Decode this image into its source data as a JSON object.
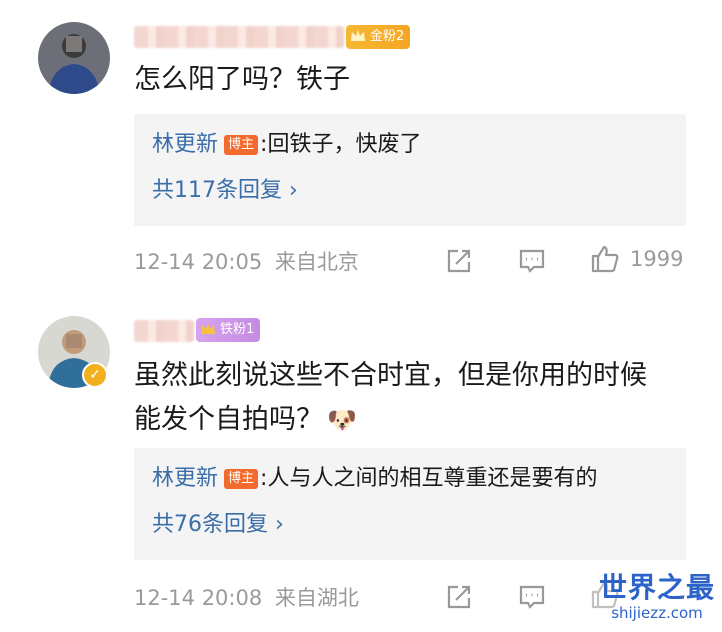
{
  "comments": [
    {
      "fan_badge": "金粉2",
      "text": "怎么阳了吗？铁子",
      "reply": {
        "name": "林更新",
        "op_badge": "博主",
        "content": ":回铁子，快废了",
        "more": "共117条回复 ›"
      },
      "time": "12-14 20:05",
      "location": "来自北京",
      "like_count": "1999"
    },
    {
      "fan_badge": "铁粉1",
      "text_line1": "虽然此刻说这些不合时宜，但是你用的时候",
      "text_line2": "能发个自拍吗？",
      "emoji": "🐶",
      "reply": {
        "name": "林更新",
        "op_badge": "博主",
        "content": ":人与人之间的相互尊重还是要有的",
        "more": "共76条回复 ›"
      },
      "time": "12-14 20:08",
      "location": "来自湖北"
    }
  ],
  "watermark": {
    "title": "世界之最",
    "url": "shijiezz.com"
  },
  "icons": {
    "share": "share-icon",
    "comment": "comment-icon",
    "like": "thumbs-up-icon",
    "verified": "verified-badge-icon"
  },
  "colors": {
    "link_blue": "#3b6ea8",
    "op_badge": "#f36b2c",
    "gold_badge": "#f5a623",
    "iron_badge": "#c58be0",
    "meta_gray": "#9a9a9a",
    "reply_bg": "#f4f4f4"
  }
}
